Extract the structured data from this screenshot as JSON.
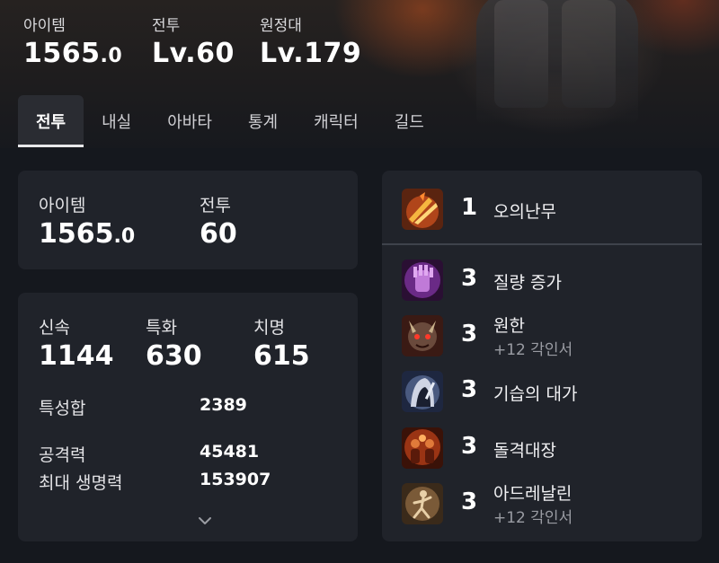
{
  "header": {
    "stats": [
      {
        "label": "아이템",
        "value_main": "1565",
        "value_dec": ".0"
      },
      {
        "label": "전투",
        "value_main": "Lv.60",
        "value_dec": ""
      },
      {
        "label": "원정대",
        "value_main": "Lv.179",
        "value_dec": ""
      }
    ]
  },
  "tabs": [
    {
      "label": "전투",
      "active": true
    },
    {
      "label": "내실",
      "active": false
    },
    {
      "label": "아바타",
      "active": false
    },
    {
      "label": "통계",
      "active": false
    },
    {
      "label": "캐릭터",
      "active": false
    },
    {
      "label": "길드",
      "active": false
    }
  ],
  "levels_card": {
    "item_label": "아이템",
    "item_value_main": "1565",
    "item_value_dec": ".0",
    "combat_label": "전투",
    "combat_value": "60"
  },
  "stats_card": {
    "primary": [
      {
        "label": "신속",
        "value": "1144"
      },
      {
        "label": "특화",
        "value": "630"
      },
      {
        "label": "치명",
        "value": "615"
      }
    ],
    "total_label": "특성합",
    "total_value": "2389",
    "attack_label": "공격력",
    "attack_value": "45481",
    "hp_label": "최대 생명력",
    "hp_value": "153907"
  },
  "engravings": [
    {
      "level": "1",
      "name": "오의난무",
      "sub": "",
      "icon": "fire-slash-icon"
    },
    {
      "level": "3",
      "name": "질량 증가",
      "sub": "",
      "icon": "purple-gauntlet-icon"
    },
    {
      "level": "3",
      "name": "원한",
      "sub": "+12 각인서",
      "icon": "demon-face-icon"
    },
    {
      "level": "3",
      "name": "기습의 대가",
      "sub": "",
      "icon": "hooded-assassin-icon"
    },
    {
      "level": "3",
      "name": "돌격대장",
      "sub": "",
      "icon": "charging-soldiers-icon"
    },
    {
      "level": "3",
      "name": "아드레날린",
      "sub": "+12 각인서",
      "icon": "running-figure-icon"
    }
  ]
}
